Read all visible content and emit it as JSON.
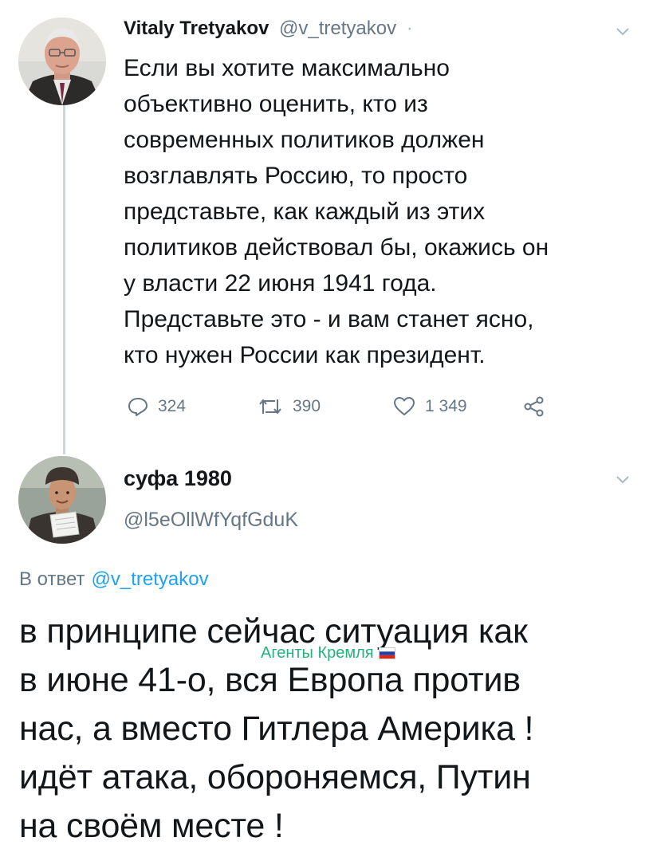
{
  "tweet1": {
    "name": "Vitaly Tretyakov",
    "handle": "@v_tretyakov",
    "time_sep": "·",
    "text": "Если вы хотите максимально\nобъективно оценить, кто из\nсовременных политиков должен\nвозглавлять Россию, то просто\nпредставьте, как каждый из этих\nполитиков действовал бы, окажись он\nу власти 22 июня 1941 года.\nПредставьте это - и вам станет ясно,\nкто нужен России как президент.",
    "replies": "324",
    "retweets": "390",
    "likes": "1 349"
  },
  "tweet2": {
    "name": "суфа 1980",
    "handle": "@l5eOllWfYqfGduK",
    "reply_prefix": "В ответ",
    "reply_handle": "@v_tretyakov",
    "text": "в принципе сейчас ситуация как\nв июне 41-о, вся Европа против\nнас, а вместо Гитлера Америка !\nидёт атака, обороняемся, Путин\nна своём месте !"
  },
  "watermark": {
    "text": "Агенты Кремля",
    "color": "#23b37a"
  },
  "colors": {
    "secondary_text": "#657786",
    "link": "#1da1f2",
    "thread_line": "#ccd6dd"
  },
  "icons": {
    "reply": "reply-icon",
    "retweet": "retweet-icon",
    "like": "heart-icon",
    "share": "share-icon",
    "menu": "chevron-down-icon"
  }
}
